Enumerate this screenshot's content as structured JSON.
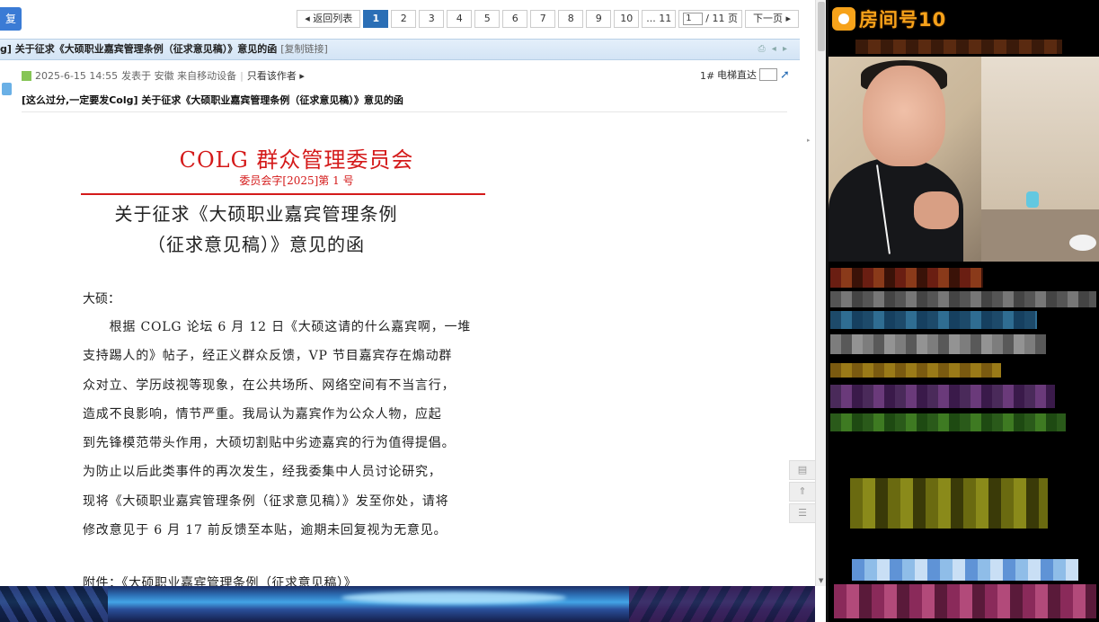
{
  "forum": {
    "reply_label": "复",
    "pager": {
      "back_label": "◂ 返回列表",
      "pages": [
        "1",
        "2",
        "3",
        "4",
        "5",
        "6",
        "7",
        "8",
        "9",
        "10"
      ],
      "active": "1",
      "last_label": "... 11",
      "current_input": "1",
      "total_label": "/ 11 页",
      "next_label": "下一页 ▸"
    },
    "thread_title": "g] 关于征求《大硕职业嘉宾管理条例（征求意见稿）》意见的函",
    "copy_link": "[复制链接]",
    "post": {
      "time": "2025-6-15 14:55",
      "published_text": "发表于 安徽 来自移动设备",
      "separator": "|",
      "only_author": "只看该作者 ▸",
      "floor": "1#",
      "elevator_label": "电梯直达",
      "subject": "[这么过分,一定要发Colg] 关于征求《大硕职业嘉宾管理条例（征求意见稿）》意见的函"
    },
    "doc": {
      "org": "COLG 群众管理委员会",
      "docno": "委员会字[2025]第 1 号",
      "title_line1": "关于征求《大硕职业嘉宾管理条例",
      "title_line2": "（征求意见稿）》意见的函",
      "salutation": "大硕：",
      "body_lines": [
        "　　根据 COLG 论坛 6 月 12 日《大硕这请的什么嘉宾啊，一堆",
        "支持踢人的》帖子，经正义群众反馈，VP 节目嘉宾存在煽动群",
        "众对立、学历歧视等现象，在公共场所、网络空间有不当言行，",
        "造成不良影响，情节严重。我局认为嘉宾作为公众人物，应起",
        "到先锋模范带头作用，大硕切割贴中劣迹嘉宾的行为值得提倡。",
        "为防止以后此类事件的再次发生，经我委集中人员讨论研究，",
        "现将《大硕职业嘉宾管理条例（征求意见稿）》发至你处，请将",
        "修改意见于 6 月 17 前反馈至本贴，逾期未回复视为无意见。"
      ],
      "attachment": "附件：《大硕职业嘉宾管理条例（征求意见稿）》"
    },
    "float_buttons": [
      "comment-icon",
      "top-icon",
      "list-icon"
    ]
  },
  "stream": {
    "room_label": "房间号10"
  },
  "colors": {
    "accent_blue": "#2b6fb6",
    "doc_red": "#d41a1a",
    "room_orange": "#f6a21a"
  }
}
